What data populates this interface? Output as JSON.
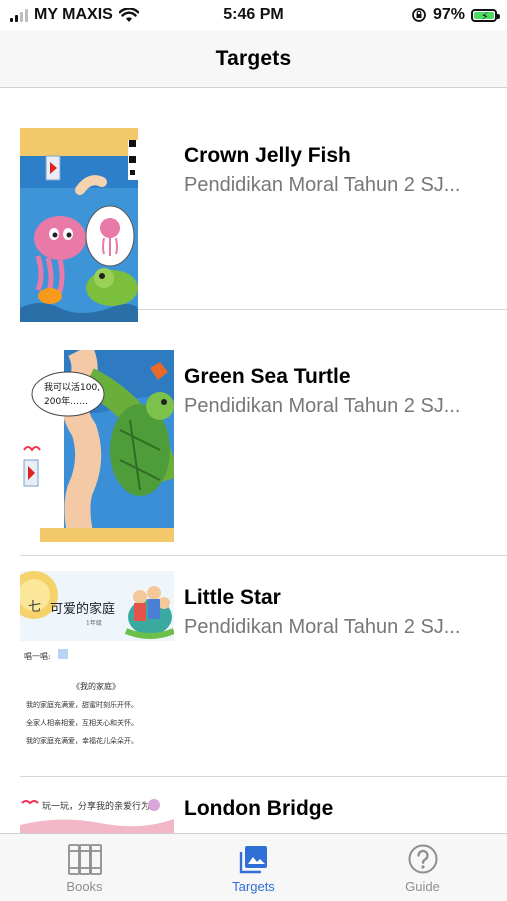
{
  "status_bar": {
    "carrier": "MY MAXIS",
    "time": "5:46 PM",
    "battery_percent": "97%",
    "signal_bars": 2,
    "icons": [
      "signal-icon",
      "wifi-icon",
      "rotation-lock-icon",
      "battery-charging-icon"
    ]
  },
  "nav": {
    "title": "Targets"
  },
  "targets": [
    {
      "title": "Crown Jelly Fish",
      "subtitle": "Pendidikan Moral Tahun 2 SJ..."
    },
    {
      "title": "Green Sea Turtle",
      "subtitle": "Pendidikan Moral Tahun 2 SJ..."
    },
    {
      "title": "Little Star",
      "subtitle": "Pendidikan Moral Tahun 2 SJ..."
    },
    {
      "title": "London Bridge",
      "subtitle": ""
    }
  ],
  "thumb_text": {
    "turtle_bubble_line1": "我可以活100,",
    "turtle_bubble_line2": "200年……",
    "star_chapter_number": "七",
    "star_chapter_title": "可爱的家庭",
    "star_chapter_sub": "1年级",
    "star_listen": "唱一唱:",
    "star_song_title": "《我的家庭》",
    "star_line1": "我的家庭充满爱，甜蜜时刻乐开怀。",
    "star_line2": "全家人相亲相爱，互相关心和关怀。",
    "star_line3": "我的家庭充满爱，幸福花儿朵朵开。",
    "bridge_text": "玩一玩，分享我的亲爱行为。"
  },
  "tabs": [
    {
      "label": "Books",
      "icon": "books-icon",
      "active": false
    },
    {
      "label": "Targets",
      "icon": "photo-icon",
      "active": true
    },
    {
      "label": "Guide",
      "icon": "question-icon",
      "active": false
    }
  ],
  "colors": {
    "accent": "#2f6fd6",
    "inactive_tab": "#8e8e93",
    "subtitle": "#777777",
    "bar_bg": "#f7f7f7",
    "battery": "#4cd964"
  }
}
